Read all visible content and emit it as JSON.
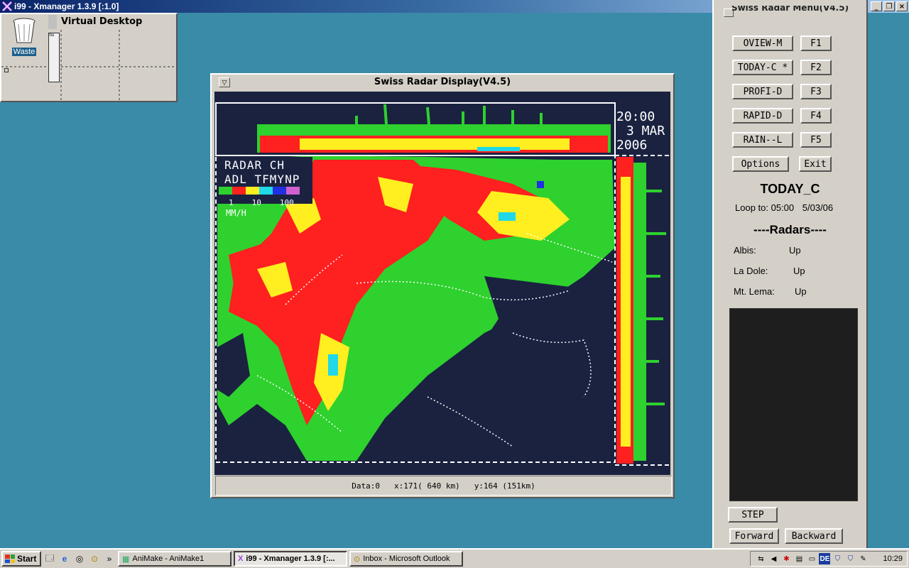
{
  "xmanager": {
    "title": "i99 - Xmanager 1.3.9 [:1.0]",
    "minimize": "_",
    "restore": "❐",
    "close": "×"
  },
  "desktop": {
    "waste_label": "Waste",
    "virtual_desktop_title": "Virtual Desktop",
    "mini_label": "Su"
  },
  "radar_window": {
    "title": "Swiss Radar Display(V4.5)",
    "time": "20:00",
    "date": "3 MAR",
    "year": "2006",
    "legend_line1": "RADAR CH",
    "legend_line2": "ADL TFMYNP",
    "legend_scale": [
      "1",
      "10",
      "100"
    ],
    "legend_unit": "MM/H",
    "legend_colors": [
      "#2ed12e",
      "#ff2020",
      "#ffee20",
      "#20d8e8",
      "#2030e0",
      "#d060d0"
    ],
    "status_data": "Data:0",
    "status_x": "x:171( 640 km)",
    "status_y": "y:164 (151km)"
  },
  "menu_panel": {
    "title": "Swiss Radar Menu(V4.5)",
    "buttons": [
      {
        "label": "OVIEW-M",
        "key": "F1"
      },
      {
        "label": "TODAY-C *",
        "key": "F2"
      },
      {
        "label": "PROFI-D",
        "key": "F3"
      },
      {
        "label": "RAPID-D",
        "key": "F4"
      },
      {
        "label": "RAIN--L",
        "key": "F5"
      }
    ],
    "options": "Options",
    "exit": "Exit",
    "mode": "TODAY_C",
    "loop_label": "Loop to: 05:00",
    "loop_date": "5/03/06",
    "radars_header": "----Radars----",
    "radars": [
      {
        "name": "Albis:",
        "status": "Up"
      },
      {
        "name": "La Dole:",
        "status": "Up"
      },
      {
        "name": "Mt. Lema:",
        "status": "Up"
      }
    ],
    "step": "STEP",
    "forward": "Forward",
    "backward": "Backward"
  },
  "taskbar": {
    "start": "Start",
    "quicklaunch_more": "»",
    "tasks": [
      {
        "label": "AniMake - AniMake1",
        "active": false
      },
      {
        "label": "i99 - Xmanager 1.3.9 [:...",
        "active": true
      },
      {
        "label": "Inbox - Microsoft Outlook",
        "active": false
      }
    ],
    "lang": "DE",
    "clock": "10:29"
  }
}
